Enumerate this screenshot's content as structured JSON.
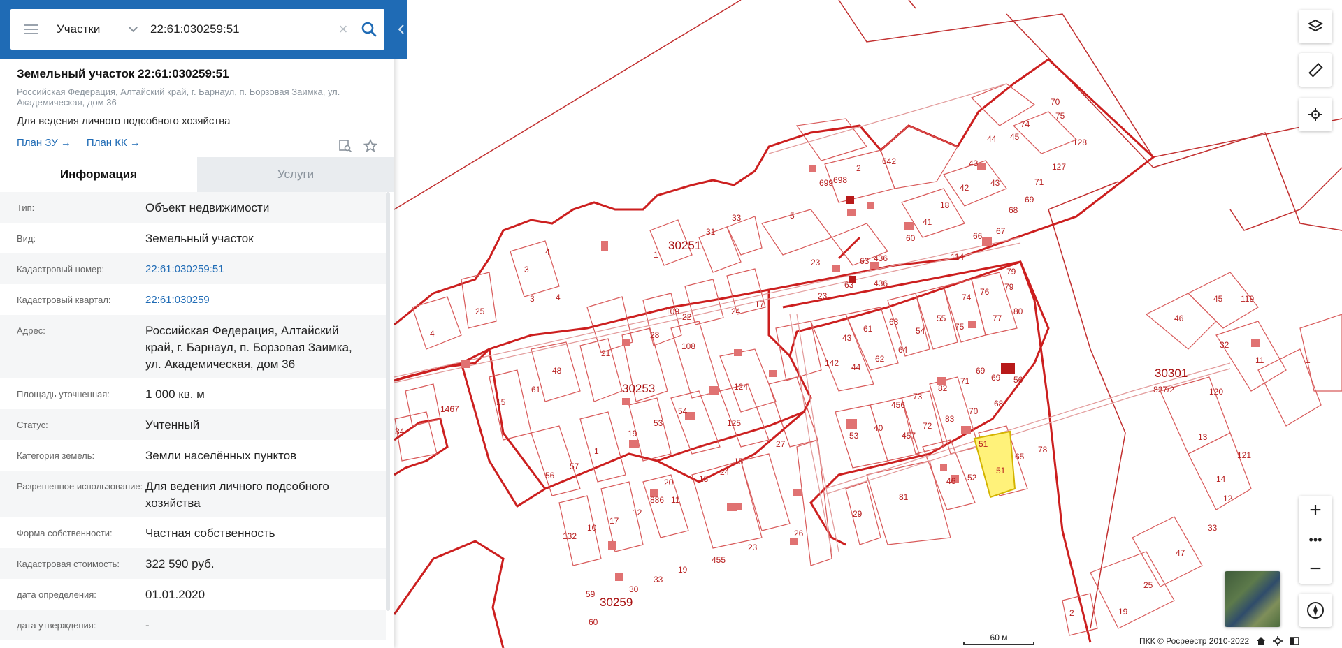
{
  "search": {
    "type_label": "Участки",
    "query": "22:61:030259:51"
  },
  "object": {
    "title": "Земельный участок 22:61:030259:51",
    "address_short": "Российская Федерация, Алтайский край, г. Барнаул, п. Борзовая Заимка, ул. Академическая, дом 36",
    "purpose": "Для ведения личного подсобного хозяйства",
    "links": {
      "plan_zu": "План ЗУ →",
      "plan_kk": "План КК →"
    }
  },
  "tabs": {
    "info": "Информация",
    "services": "Услуги"
  },
  "rows": [
    {
      "label": "Тип:",
      "value": "Объект недвижимости"
    },
    {
      "label": "Вид:",
      "value": "Земельный участок"
    },
    {
      "label": "Кадастровый номер:",
      "value": "22:61:030259:51"
    },
    {
      "label": "Кадастровый квартал:",
      "value": "22:61:030259"
    },
    {
      "label": "Адрес:",
      "value": "Российская Федерация, Алтайский край, г. Барнаул, п. Борзовая Заимка, ул. Академическая, дом 36"
    },
    {
      "label": "Площадь уточненная:",
      "value": "1 000 кв. м"
    },
    {
      "label": "Статус:",
      "value": "Учтенный"
    },
    {
      "label": "Категория земель:",
      "value": "Земли населённых пунктов"
    },
    {
      "label": "Разрешенное использование:",
      "value": "Для ведения личного подсобного хозяйства"
    },
    {
      "label": "Форма собственности:",
      "value": "Частная собственность"
    },
    {
      "label": "Кадастровая стоимость:",
      "value": "322 590 руб."
    },
    {
      "label": "дата определения:",
      "value": "01.01.2020"
    },
    {
      "label": "дата утверждения:",
      "value": "-"
    }
  ],
  "map": {
    "quarter_labels": [
      "30251",
      "30253",
      "30259",
      "30301"
    ],
    "parcel_labels": [
      "70",
      "75",
      "128",
      "45",
      "44",
      "74",
      "127",
      "43",
      "42",
      "71",
      "69",
      "68",
      "67",
      "66",
      "18",
      "41",
      "60",
      "114",
      "642",
      "2",
      "698",
      "699",
      "5",
      "33",
      "31",
      "30251",
      "1",
      "436",
      "63",
      "23",
      "79",
      "76",
      "74",
      "77",
      "80",
      "25",
      "4",
      "3",
      "109",
      "22",
      "24",
      "17",
      "28",
      "108",
      "21",
      "48",
      "61",
      "15",
      "1467",
      "34",
      "142",
      "43",
      "61",
      "63",
      "54",
      "55",
      "75",
      "44",
      "62",
      "64",
      "69",
      "56",
      "71",
      "82",
      "73",
      "456",
      "68",
      "53",
      "40",
      "457",
      "72",
      "83",
      "70",
      "51",
      "65",
      "78",
      "124",
      "125",
      "30253",
      "54",
      "19",
      "53",
      "1",
      "56",
      "57",
      "27",
      "15",
      "24",
      "18",
      "20",
      "11",
      "886",
      "12",
      "17",
      "10",
      "132",
      "46",
      "52",
      "81",
      "29",
      "26",
      "23",
      "455",
      "19",
      "33",
      "30",
      "59",
      "60",
      "2",
      "19",
      "25",
      "47",
      "33",
      "12",
      "14",
      "121",
      "13",
      "120",
      "11",
      "1",
      "30301",
      "46",
      "45",
      "119",
      "32",
      "827/2"
    ],
    "scale_label": "60 м",
    "copyright": "ПКК © Росреестр 2010-2022",
    "highlight_color": "#fff27a",
    "parcel_color": "#cc1f1f"
  }
}
